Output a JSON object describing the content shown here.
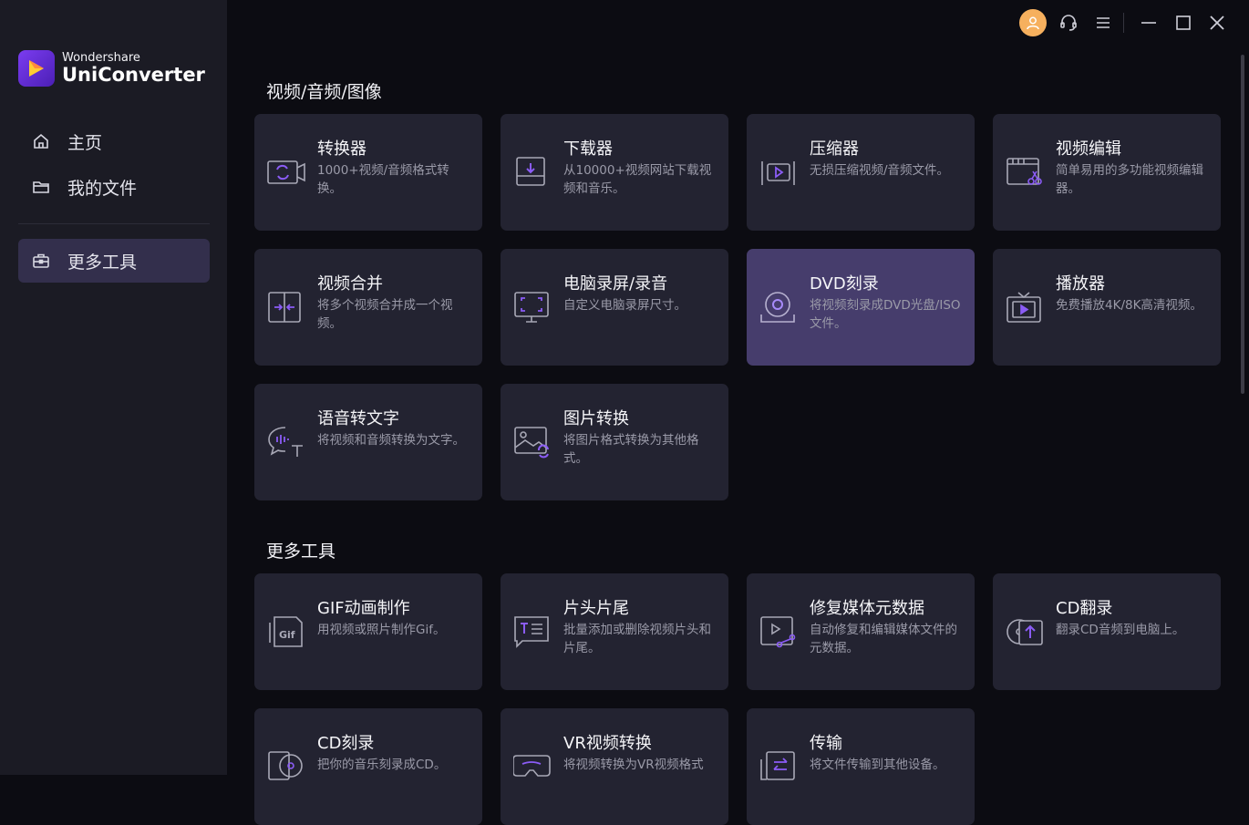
{
  "app": {
    "brand": "Wondershare",
    "product": "UniConverter"
  },
  "sidebar": {
    "items": [
      {
        "label": "主页",
        "icon": "home-icon"
      },
      {
        "label": "我的文件",
        "icon": "folder-icon"
      },
      {
        "label": "更多工具",
        "icon": "toolbox-icon",
        "active": true
      }
    ]
  },
  "titlebar": {
    "icons": [
      "avatar-icon",
      "support-headset-icon",
      "menu-icon",
      "minimize-icon",
      "maximize-icon",
      "close-icon"
    ]
  },
  "sections": [
    {
      "title": "视频/音频/图像",
      "cards": [
        {
          "title": "转换器",
          "desc": "1000+视频/音频格式转换。",
          "icon": "converter-icon"
        },
        {
          "title": "下载器",
          "desc": "从10000+视频网站下载视频和音乐。",
          "icon": "downloader-icon"
        },
        {
          "title": "压缩器",
          "desc": "无损压缩视频/音频文件。",
          "icon": "compressor-icon"
        },
        {
          "title": "视频编辑",
          "desc": "简单易用的多功能视频编辑器。",
          "icon": "video-editor-icon"
        },
        {
          "title": "视频合并",
          "desc": "将多个视频合并成一个视频。",
          "icon": "merger-icon"
        },
        {
          "title": "电脑录屏/录音",
          "desc": "自定义电脑录屏尺寸。",
          "icon": "screen-recorder-icon"
        },
        {
          "title": "DVD刻录",
          "desc": "将视频刻录成DVD光盘/ISO文件。",
          "icon": "dvd-burner-icon",
          "highlight": true
        },
        {
          "title": "播放器",
          "desc": "免费播放4K/8K高清视频。",
          "icon": "player-icon"
        },
        {
          "title": "语音转文字",
          "desc": "将视频和音频转换为文字。",
          "icon": "speech-to-text-icon"
        },
        {
          "title": "图片转换",
          "desc": "将图片格式转换为其他格式。",
          "icon": "image-converter-icon"
        }
      ]
    },
    {
      "title": "更多工具",
      "cards": [
        {
          "title": "GIF动画制作",
          "desc": "用视频或照片制作Gif。",
          "icon": "gif-maker-icon"
        },
        {
          "title": "片头片尾",
          "desc": "批量添加或删除视频片头和片尾。",
          "icon": "intro-outro-icon"
        },
        {
          "title": "修复媒体元数据",
          "desc": "自动修复和编辑媒体文件的元数据。",
          "icon": "metadata-icon"
        },
        {
          "title": "CD翻录",
          "desc": "翻录CD音频到电脑上。",
          "icon": "cd-ripper-icon"
        },
        {
          "title": "CD刻录",
          "desc": "把你的音乐刻录成CD。",
          "icon": "cd-burner-icon"
        },
        {
          "title": "VR视频转换",
          "desc": "将视频转换为VR视频格式",
          "icon": "vr-converter-icon"
        },
        {
          "title": "传输",
          "desc": "将文件传输到其他设备。",
          "icon": "transfer-icon"
        }
      ]
    }
  ],
  "colors": {
    "accent": "#8b5cf6",
    "card_bg": "#232331",
    "card_highlight": "#463d6c",
    "sidebar_bg": "#1b1b24",
    "main_bg": "#0c0c12"
  }
}
